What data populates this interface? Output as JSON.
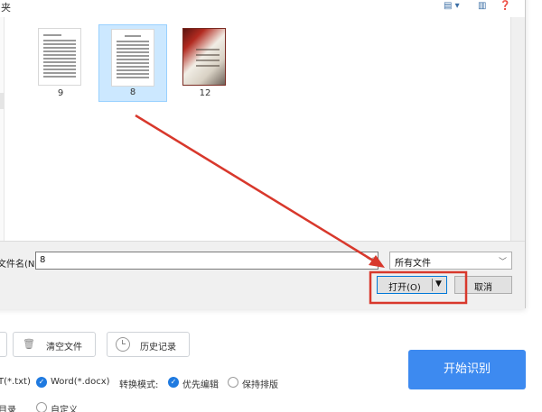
{
  "dialog": {
    "breadcrumb": "夹",
    "files": [
      {
        "name": "9",
        "kind": "document",
        "selected": false
      },
      {
        "name": "8",
        "kind": "document",
        "selected": true
      },
      {
        "name": "12",
        "kind": "photo",
        "selected": false
      }
    ],
    "filename_label": "文件名(N):",
    "filename_value": "8",
    "filetype_value": "所有文件",
    "open_label": "打开(O)",
    "cancel_label": "取消"
  },
  "annotation": {
    "color": "#d8382c"
  },
  "app": {
    "clear_files_label": "清空文件",
    "history_label": "历史记录",
    "format_txt_label": "T(*.txt)",
    "format_word_label": "Word(*.docx)",
    "convert_mode_label": "转换模式:",
    "mode_edit_label": "优先编辑",
    "mode_layout_label": "保持排版",
    "dir_label": "目录",
    "custom_label": "自定义",
    "start_label": "开始识别"
  },
  "colors": {
    "accent": "#3d8af0",
    "check": "#1f7ae0"
  }
}
